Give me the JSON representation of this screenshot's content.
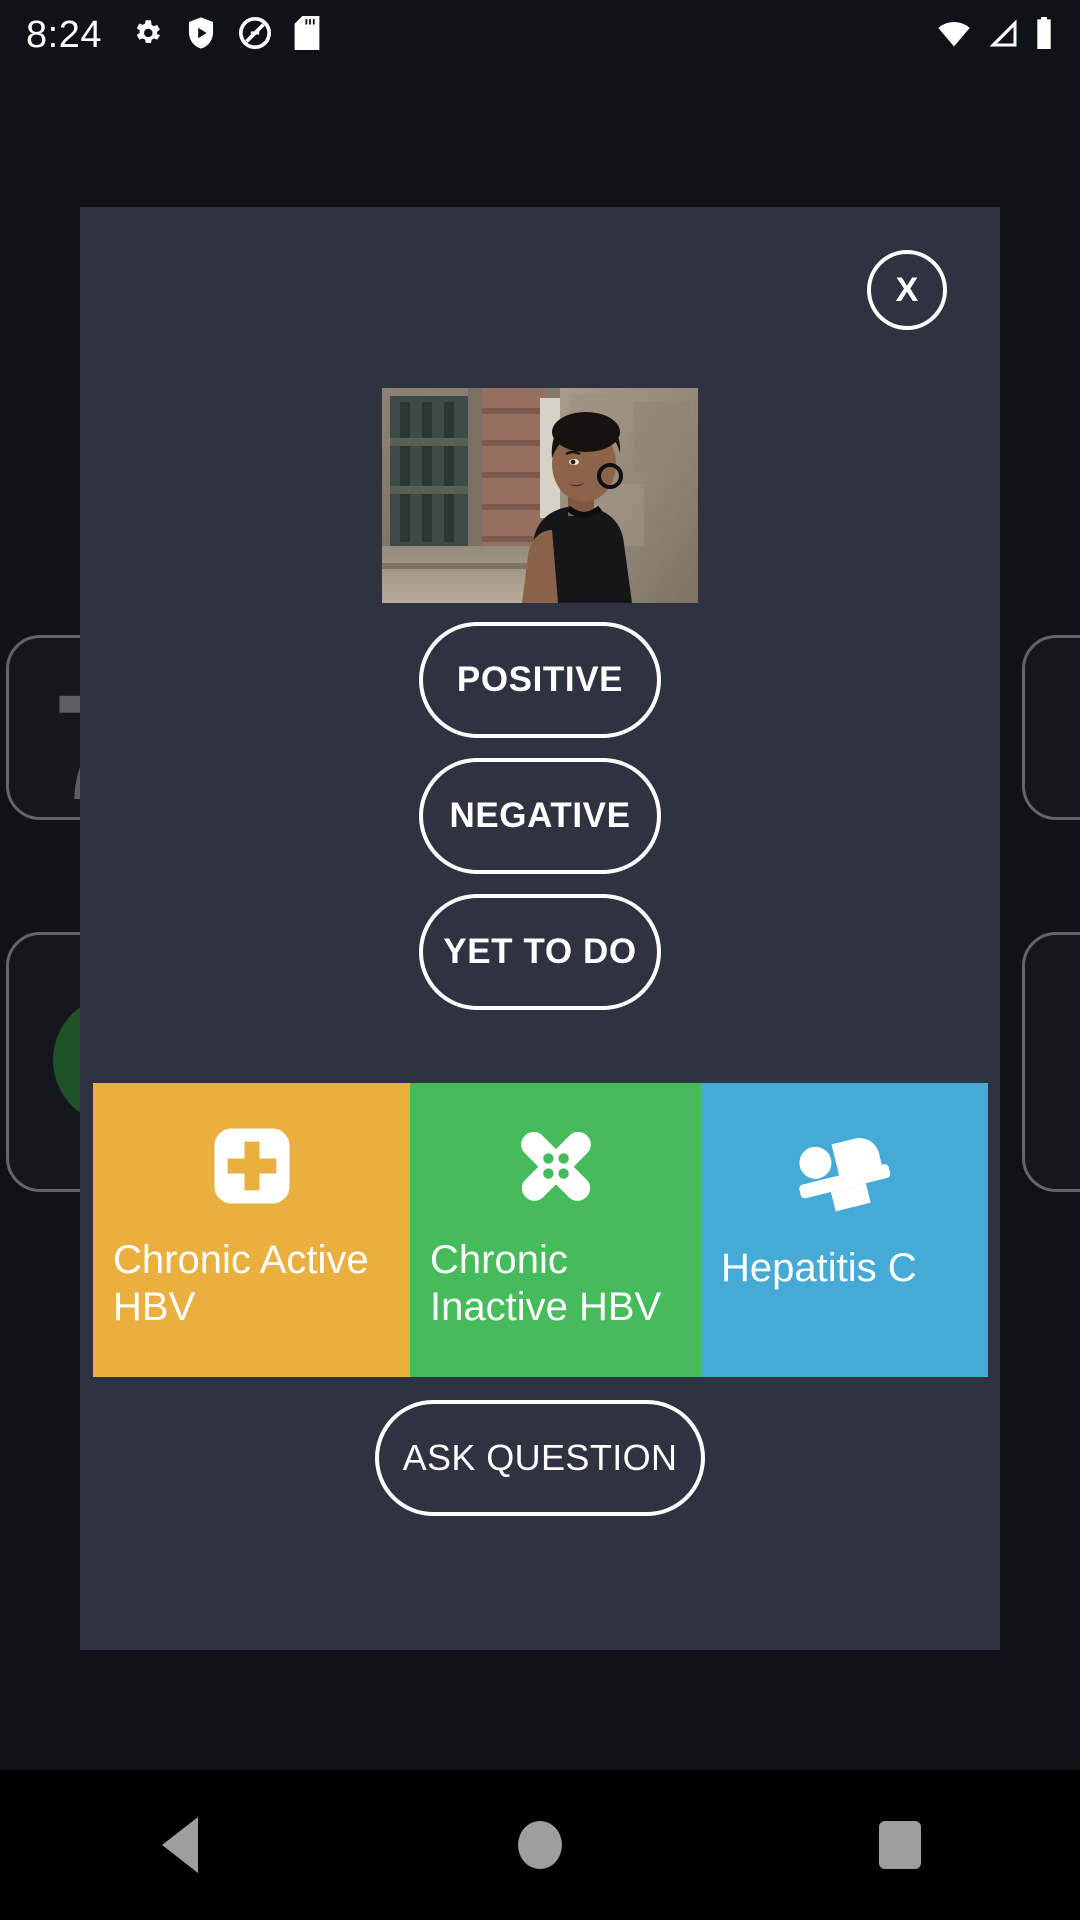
{
  "status_bar": {
    "time": "8:24",
    "left_icons": [
      "gear-icon",
      "play-protect-shield-icon",
      "do-not-disturb-icon",
      "sd-card-icon"
    ],
    "right_icons": [
      "wifi-icon",
      "cellular-signal-icon",
      "battery-icon"
    ]
  },
  "background": {
    "cards": [
      {
        "content": "7",
        "type": "number"
      },
      {
        "content": "",
        "type": "circle"
      },
      {
        "content": "",
        "type": "empty"
      },
      {
        "content": "",
        "type": "empty"
      }
    ]
  },
  "modal": {
    "close_label": "X",
    "photo": {
      "alt": "Portrait of a woman with short hair in a black sleeveless top against a stone wall"
    },
    "status_buttons": [
      {
        "label": "POSITIVE"
      },
      {
        "label": "NEGATIVE"
      },
      {
        "label": "YET TO DO"
      }
    ],
    "condition_tiles": [
      {
        "label": "Chronic Active HBV",
        "icon": "medical-cross-icon",
        "color": "#eaaf3f"
      },
      {
        "label": "Chronic Inactive HBV",
        "icon": "bandage-cross-icon",
        "color": "#46bb5c"
      },
      {
        "label": "Hepatitis C",
        "icon": "patient-in-bed-icon",
        "color": "#45abd6"
      }
    ],
    "ask_button_label": "ASK QUESTION"
  },
  "nav_bar": {
    "back_label": "Back",
    "home_label": "Home",
    "recents_label": "Recents"
  }
}
